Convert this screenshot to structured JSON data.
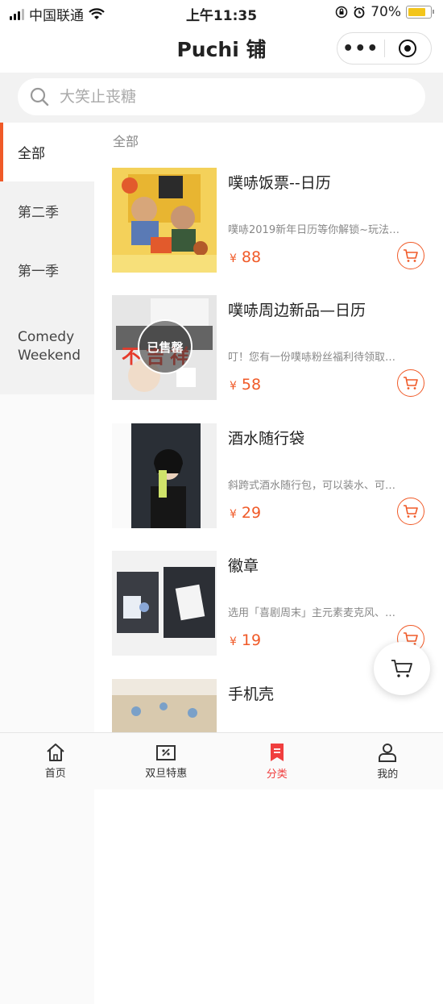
{
  "status_bar": {
    "carrier": "中国联通",
    "time": "上午11:35",
    "battery": "70%"
  },
  "nav": {
    "title": "Puchi 铺",
    "more_label": "•••"
  },
  "search": {
    "placeholder": "大笑止丧糖"
  },
  "sidebar": {
    "items": [
      {
        "label": "全部",
        "active": true
      },
      {
        "label": "第二季",
        "active": false
      },
      {
        "label": "第一季",
        "active": false
      },
      {
        "label": "Comedy Weekend",
        "active": false
      }
    ]
  },
  "content": {
    "section_title": "全部",
    "currency": "¥",
    "products": [
      {
        "name": "噗哧饭票--日历",
        "desc": "噗哧2019新年日历等你解锁~玩法…",
        "price": "88"
      },
      {
        "name": "噗哧周边新品—日历",
        "desc": "叮！您有一份噗哧粉丝福利待领取…",
        "price": "58",
        "sold_out_label": "已售罄",
        "overlay_text": "不吉祥"
      },
      {
        "name": "酒水随行袋",
        "desc": "斜跨式酒水随行包，可以装水、可…",
        "price": "29"
      },
      {
        "name": "徽章",
        "desc": "选用「喜剧周末」主元素麦克风、…",
        "price": "19"
      },
      {
        "name": "手机壳",
        "desc": "",
        "price": ""
      }
    ]
  },
  "tabbar": {
    "tabs": [
      {
        "label": "首页",
        "icon": "home-icon"
      },
      {
        "label": "双旦特惠",
        "icon": "discount-ticket-icon"
      },
      {
        "label": "分类",
        "icon": "category-bookmark-icon",
        "active": true
      },
      {
        "label": "我的",
        "icon": "profile-icon"
      }
    ]
  },
  "colors": {
    "accent": "#f05a28",
    "tab_active": "#f03e3e",
    "sidebar_bg": "#f2f2f2"
  }
}
